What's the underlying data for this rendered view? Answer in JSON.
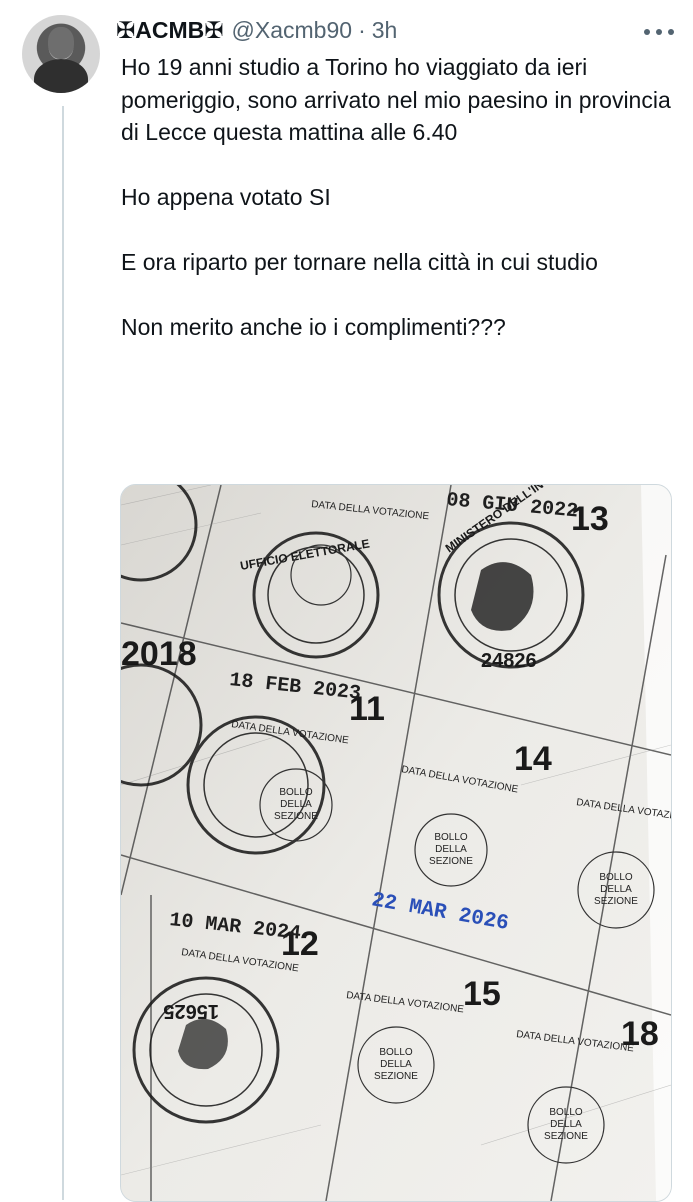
{
  "tweet": {
    "display_name": "✠ACMB✠",
    "handle": "@Xacmb90",
    "separator": "·",
    "time": "3h",
    "paragraphs": [
      "Ho 19 anni studio a Torino ho viaggiato da ieri pomeriggio, sono arrivato nel mio paesino in provincia di Lecce questa mattina alle 6.40",
      "Ho appena votato SI",
      "E ora riparto per tornare nella città in cui studio",
      "Non merito anche io i complimenti???"
    ]
  },
  "media": {
    "card_label": "DATA DELLA VOTAZIONE",
    "bollo_line1": "BOLLO",
    "bollo_line2": "DELLA",
    "bollo_line3": "SEZIONE",
    "numbers": [
      "2018",
      "11",
      "12",
      "13",
      "14",
      "15",
      "18"
    ],
    "dates": [
      "08 GIU 2022",
      "18 FEB 2023",
      "10 MAR 2024",
      "22 MAR 2026"
    ],
    "stamp_texts": [
      "MINISTERO DELL'INTERNO",
      "UFFICIO ELETTORALE",
      "24826",
      "15625"
    ]
  },
  "colors": {
    "text": "#0f1419",
    "muted": "#536471",
    "divider": "#cfd9de",
    "blue_stamp": "#2a4fb8"
  },
  "icons": {
    "more": "more-horizontal-icon"
  }
}
